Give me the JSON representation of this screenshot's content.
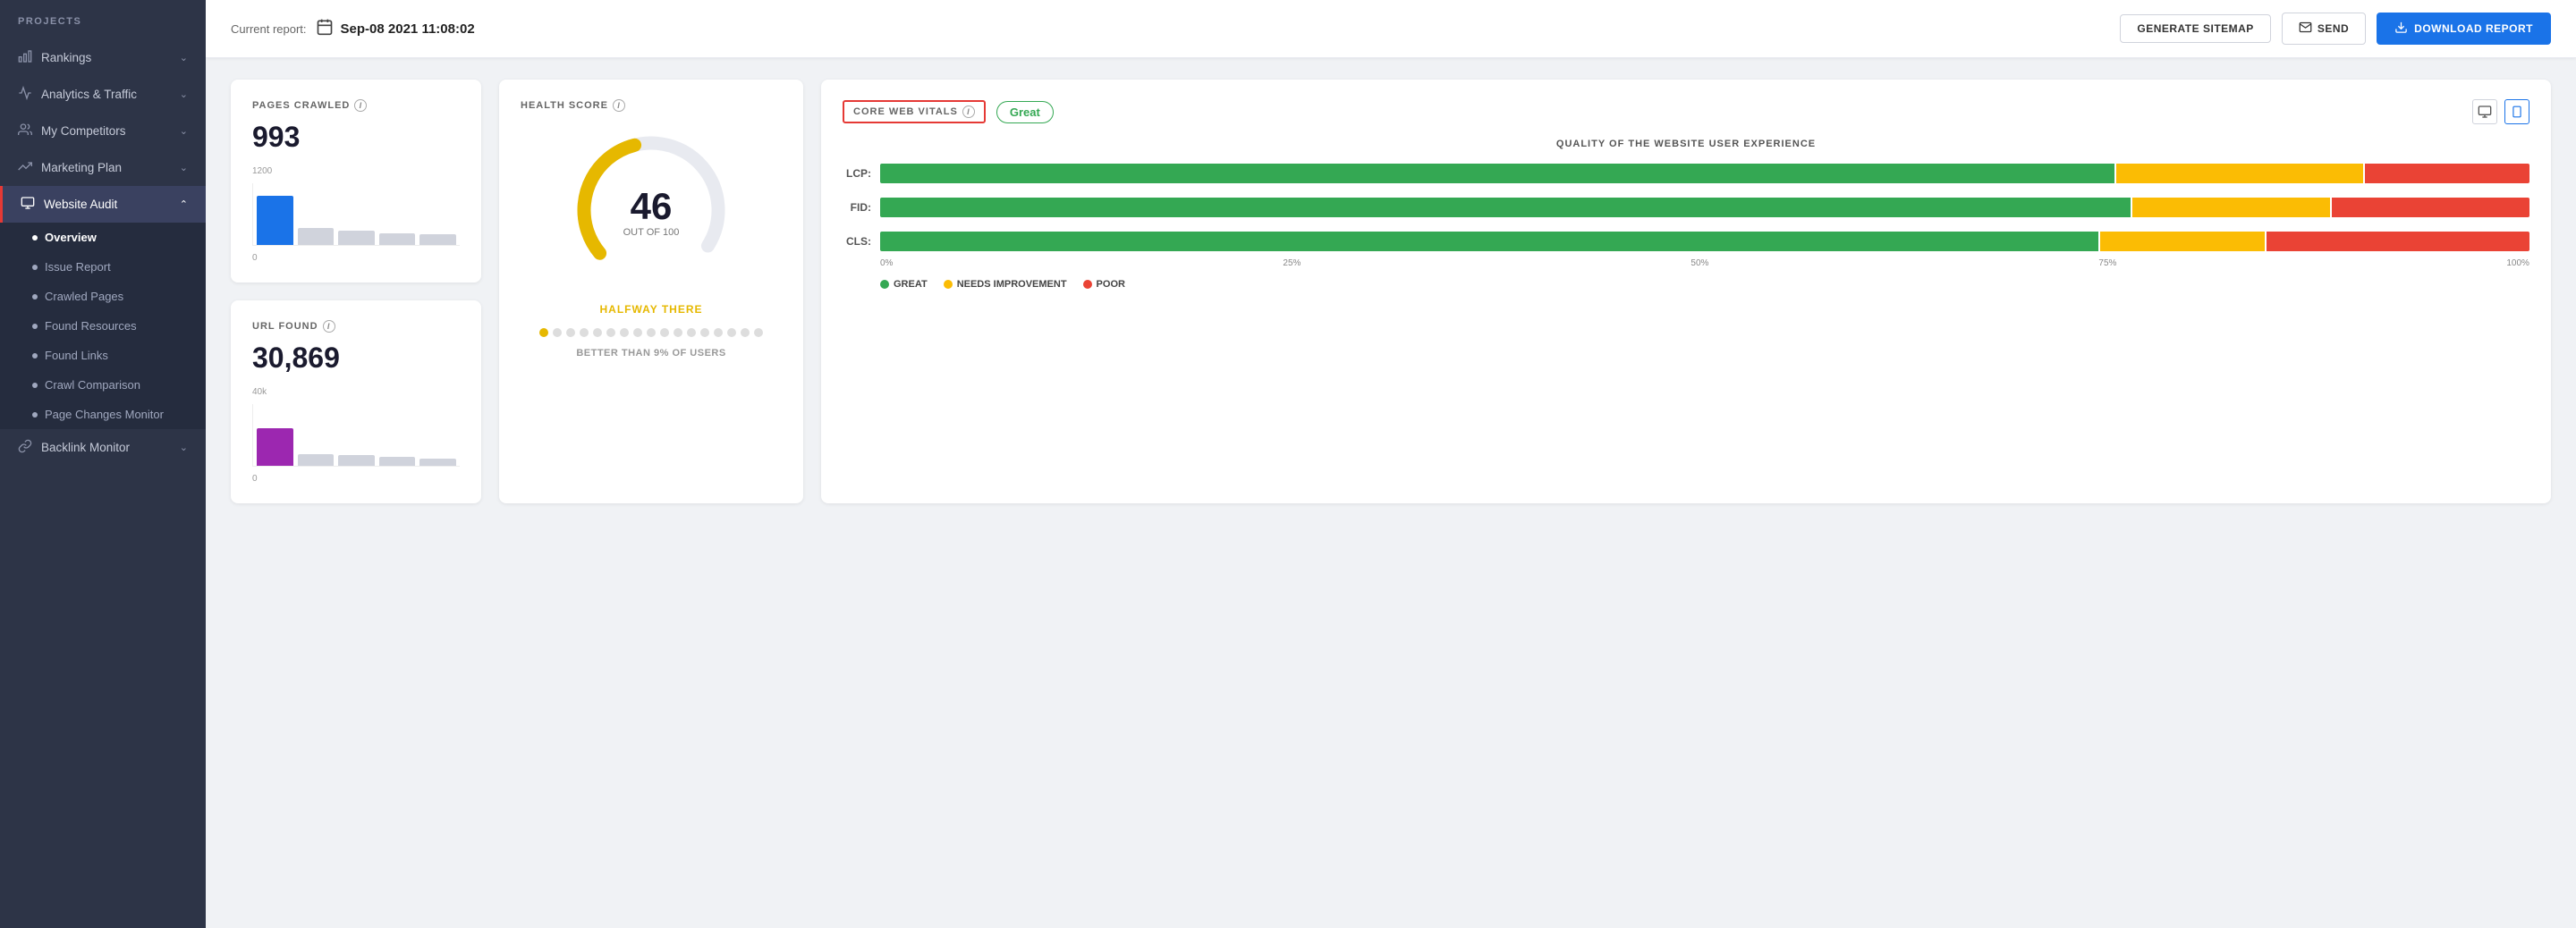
{
  "sidebar": {
    "header": "PROJECTS",
    "items": [
      {
        "id": "rankings",
        "label": "Rankings",
        "icon": "bar-chart",
        "hasChevron": true,
        "active": false
      },
      {
        "id": "analytics",
        "label": "Analytics & Traffic",
        "icon": "activity",
        "hasChevron": true,
        "active": false
      },
      {
        "id": "competitors",
        "label": "My Competitors",
        "icon": "users",
        "hasChevron": true,
        "active": false
      },
      {
        "id": "marketing",
        "label": "Marketing Plan",
        "icon": "trending",
        "hasChevron": true,
        "active": false
      },
      {
        "id": "website-audit",
        "label": "Website Audit",
        "icon": "monitor",
        "hasChevron": true,
        "active": true
      }
    ],
    "subItems": [
      {
        "id": "overview",
        "label": "Overview",
        "active": true
      },
      {
        "id": "issue-report",
        "label": "Issue Report",
        "active": false
      },
      {
        "id": "crawled-pages",
        "label": "Crawled Pages",
        "active": false
      },
      {
        "id": "found-resources",
        "label": "Found Resources",
        "active": false
      },
      {
        "id": "found-links",
        "label": "Found Links",
        "active": false
      },
      {
        "id": "crawl-comparison",
        "label": "Crawl Comparison",
        "active": false
      },
      {
        "id": "page-changes",
        "label": "Page Changes Monitor",
        "active": false
      }
    ],
    "backlink": {
      "id": "backlink-monitor",
      "label": "Backlink Monitor",
      "hasChevron": true
    }
  },
  "topbar": {
    "report_label": "Current report:",
    "report_date": "Sep-08 2021 11:08:02",
    "btn_sitemap": "GENERATE SITEMAP",
    "btn_send": "SEND",
    "btn_download": "DOWNLOAD REPORT"
  },
  "pages_crawled": {
    "title": "PAGES CRAWLED",
    "value": "993",
    "chart_max": "1200",
    "chart_min": "0",
    "bars": [
      {
        "height": 85,
        "color": "#1a73e8"
      },
      {
        "height": 30,
        "color": "#d0d3dc"
      },
      {
        "height": 25,
        "color": "#d0d3dc"
      },
      {
        "height": 20,
        "color": "#d0d3dc"
      },
      {
        "height": 18,
        "color": "#d0d3dc"
      }
    ]
  },
  "url_found": {
    "title": "URL FOUND",
    "value": "30,869",
    "chart_max": "40k",
    "chart_min": "0",
    "bars": [
      {
        "height": 65,
        "color": "#9c27b0"
      },
      {
        "height": 20,
        "color": "#d0d3dc"
      },
      {
        "height": 18,
        "color": "#d0d3dc"
      },
      {
        "height": 15,
        "color": "#d0d3dc"
      },
      {
        "height": 12,
        "color": "#d0d3dc"
      }
    ]
  },
  "health_score": {
    "title": "HEALTH SCORE",
    "value": "46",
    "out_of": "OUT OF 100",
    "status": "HALFWAY THERE",
    "status_color": "#e6b800",
    "better_than": "BETTER THAN",
    "percent": "9%",
    "of_users": "OF USERS",
    "gauge_value": 46,
    "gauge_color": "#e6b800",
    "dots_total": 17,
    "dots_active": 1
  },
  "core_web_vitals": {
    "title": "CORE WEB VITALS",
    "badge": "Great",
    "subtitle": "QUALITY OF THE WEBSITE USER EXPERIENCE",
    "metrics": [
      {
        "label": "LCP:",
        "green": 75,
        "yellow": 15,
        "red": 10
      },
      {
        "label": "FID:",
        "green": 76,
        "yellow": 12,
        "red": 12
      },
      {
        "label": "CLS:",
        "green": 74,
        "yellow": 10,
        "red": 16
      }
    ],
    "axis": [
      "0%",
      "25%",
      "50%",
      "75%",
      "100%"
    ],
    "legend": [
      {
        "label": "GREAT",
        "color": "#34a853"
      },
      {
        "label": "NEEDS IMPROVEMENT",
        "color": "#fbbc04"
      },
      {
        "label": "POOR",
        "color": "#ea4335"
      }
    ],
    "device_desktop": "🖥",
    "device_mobile": "📱"
  }
}
